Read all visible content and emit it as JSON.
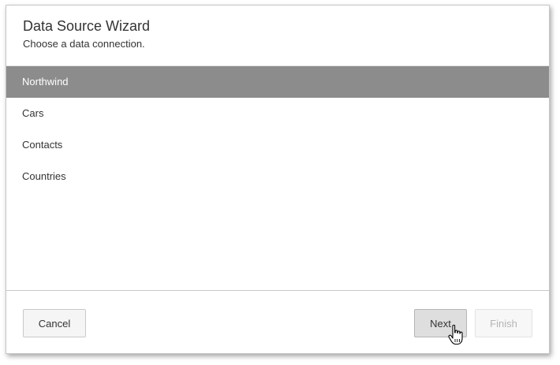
{
  "dialog": {
    "title": "Data Source Wizard",
    "subtitle": "Choose a data connection."
  },
  "connections": {
    "selected_index": 0,
    "items": [
      {
        "label": "Northwind"
      },
      {
        "label": "Cars"
      },
      {
        "label": "Contacts"
      },
      {
        "label": "Countries"
      }
    ]
  },
  "footer": {
    "cancel_label": "Cancel",
    "next_label": "Next",
    "finish_label": "Finish",
    "finish_enabled": false
  },
  "cursor": {
    "icon": "hand-pointer-icon"
  },
  "colors": {
    "selected_background": "#8c8c8c",
    "selected_text": "#ffffff"
  }
}
